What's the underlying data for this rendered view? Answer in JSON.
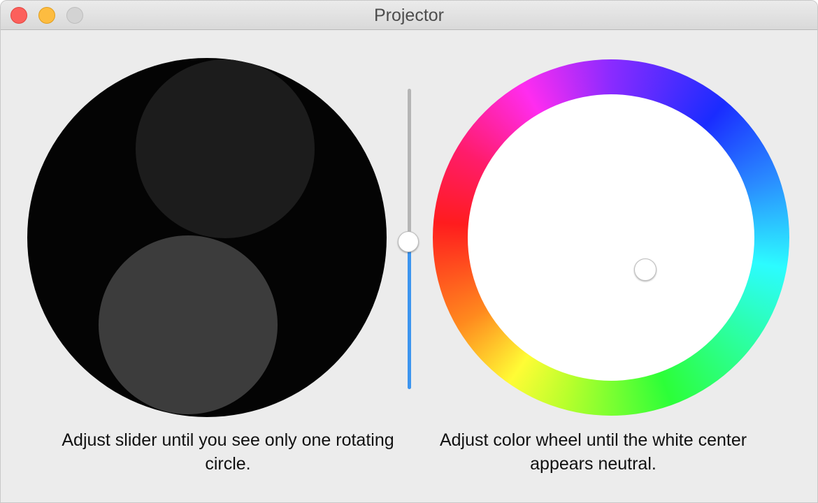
{
  "window": {
    "title": "Projector",
    "controls": {
      "close": "close",
      "minimize": "minimize",
      "zoom": "zoom"
    }
  },
  "left_panel": {
    "caption": "Adjust slider until you see only one rotating circle."
  },
  "slider": {
    "value_fraction": 0.49,
    "orientation": "vertical",
    "fill_color": "#3d95ef",
    "track_color": "#b5b5b5"
  },
  "right_panel": {
    "caption": "Adjust color wheel until the white center appears neutral.",
    "wheel_selection": "center"
  },
  "colors": {
    "close": "#fc605c",
    "minimize": "#fdbc40",
    "zoom_disabled": "#d3d3d3",
    "background": "#ececec",
    "disc": "#040404",
    "inner_top": "#1c1c1c",
    "inner_bottom": "#3c3c3c"
  }
}
